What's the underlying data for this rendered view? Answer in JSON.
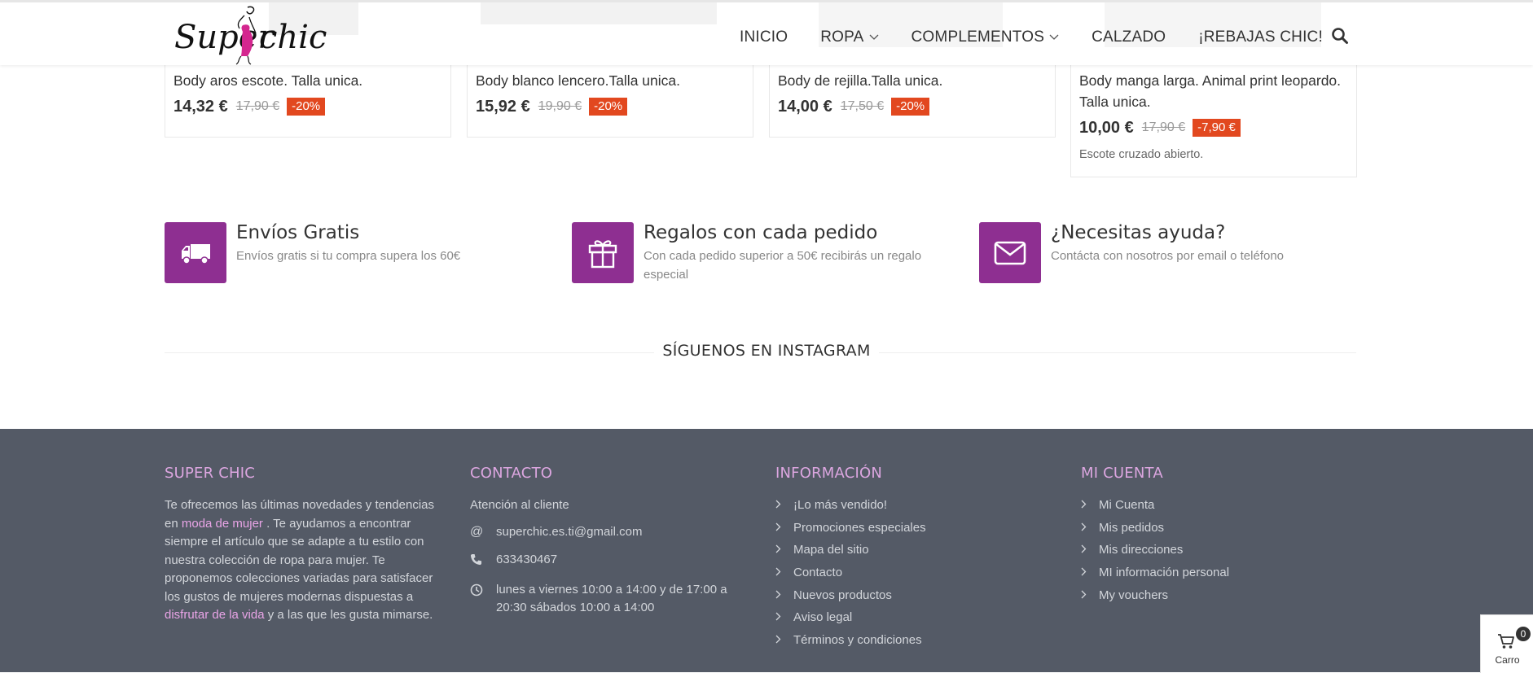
{
  "header": {
    "logo_text_left": "Super",
    "logo_text_right": "chic",
    "nav": [
      {
        "label": "INICIO",
        "dropdown": false
      },
      {
        "label": "ROPA",
        "dropdown": true
      },
      {
        "label": "COMPLEMENTOS",
        "dropdown": true
      },
      {
        "label": "CALZADO",
        "dropdown": false
      },
      {
        "label": "¡REBAJAS CHIC!",
        "dropdown": false
      }
    ],
    "search_icon": "search-icon"
  },
  "products": [
    {
      "name": "Body aros escote. Talla unica.",
      "price": "14,32 €",
      "old_price": "17,90 €",
      "discount": "-20%",
      "note": ""
    },
    {
      "name": "Body blanco lencero.Talla unica.",
      "price": "15,92 €",
      "old_price": "19,90 €",
      "discount": "-20%",
      "note": ""
    },
    {
      "name": "Body de rejilla.Talla unica.",
      "price": "14,00 €",
      "old_price": "17,50 €",
      "discount": "-20%",
      "note": ""
    },
    {
      "name": "Body manga larga. Animal print leopardo. Talla unica.",
      "price": "10,00 €",
      "old_price": "17,90 €",
      "discount": "-7,90 €",
      "note": "Escote cruzado abierto."
    }
  ],
  "features": [
    {
      "icon": "truck-icon",
      "title": "Envíos Gratis",
      "desc": "Envíos gratis si tu compra supera los 60€"
    },
    {
      "icon": "gift-icon",
      "title": "Regalos con cada pedido",
      "desc": "Con cada pedido superior a 50€ recibirás un regalo especial"
    },
    {
      "icon": "envelope-icon",
      "title": "¿Necesitas ayuda?",
      "desc": "Contácta con nosotros por email o teléfono"
    }
  ],
  "instagram": {
    "title": "SÍGUENOS EN INSTAGRAM"
  },
  "footer": {
    "about": {
      "heading": "SUPER CHIC",
      "t1": "Te ofrecemos las últimas novedades y tendencias en ",
      "link1": "moda de mujer",
      "t2": " . Te ayudamos a encontrar siempre el artículo que se adapte a tu estilo con nuestra colección de ropa para mujer. Te proponemos colecciones variadas para satisfacer los gustos de mujeres modernas dispuestas a ",
      "link2": "disfrutar de la vida",
      "t3": " y a las que les gusta mimarse."
    },
    "contact": {
      "heading": "CONTACTO",
      "attention": "Atención al cliente",
      "email": "superchic.es.ti@gmail.com",
      "phone": "633430467",
      "hours": "lunes a viernes 10:00 a 14:00 y de 17:00 a 20:30 sábados 10:00 a 14:00"
    },
    "info": {
      "heading": "INFORMACIÓN",
      "links": [
        "¡Lo más vendido!",
        "Promociones especiales",
        "Mapa del sitio",
        "Contacto",
        "Nuevos productos",
        "Aviso legal",
        "Términos y condiciones"
      ]
    },
    "account": {
      "heading": "MI CUENTA",
      "links": [
        "Mi Cuenta",
        "Mis pedidos",
        "Mis direcciones",
        "MI información personal",
        "My vouchers"
      ]
    }
  },
  "cart": {
    "count": "0",
    "label": "Carro"
  },
  "colors": {
    "accent": "#8e2f91",
    "discount": "#e2481f",
    "footer_bg": "#545a66",
    "footer_heading": "#dca6e0"
  }
}
